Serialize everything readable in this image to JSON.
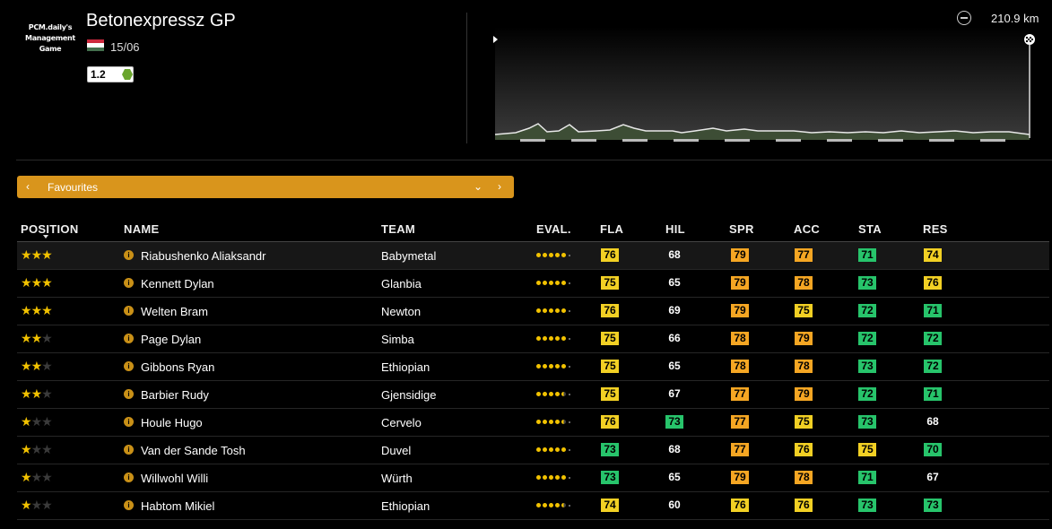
{
  "logo": {
    "line1": "PCM.daily's",
    "line2": "Management",
    "line3": "Game"
  },
  "race": {
    "title": "Betonexpressz GP",
    "date": "15/06",
    "category": "1.2",
    "flag_colors": [
      "#cd2a3e",
      "#ffffff",
      "#436f4d"
    ],
    "distance": "210.9 km"
  },
  "selector": {
    "label": "Favourites",
    "prev_icon": "chevron-left-icon",
    "dropdown_icon": "chevron-down-icon",
    "next_icon": "chevron-right-icon"
  },
  "colors": {
    "accent": "#d9951c",
    "orange": "#f5a623",
    "yellow": "#f2d024",
    "green": "#27c46b",
    "category_green": "#6aa52d"
  },
  "table": {
    "columns": [
      "POSITION",
      "NAME",
      "TEAM",
      "EVAL.",
      "FLA",
      "HIL",
      "SPR",
      "ACC",
      "STA",
      "RES"
    ],
    "rows": [
      {
        "stars": 3,
        "name": "Riabushenko Aliaksandr",
        "team": "Babymetal",
        "eval": 5,
        "FLA": "76",
        "HIL": "68",
        "SPR": "79",
        "ACC": "77",
        "STA": "71",
        "RES": "74"
      },
      {
        "stars": 3,
        "name": "Kennett Dylan",
        "team": "Glanbia",
        "eval": 5,
        "FLA": "75",
        "HIL": "65",
        "SPR": "79",
        "ACC": "78",
        "STA": "73",
        "RES": "76"
      },
      {
        "stars": 3,
        "name": "Welten Bram",
        "team": "Newton",
        "eval": 5,
        "FLA": "76",
        "HIL": "69",
        "SPR": "79",
        "ACC": "75",
        "STA": "72",
        "RES": "71"
      },
      {
        "stars": 2,
        "name": "Page Dylan",
        "team": "Simba",
        "eval": 5,
        "FLA": "75",
        "HIL": "66",
        "SPR": "78",
        "ACC": "79",
        "STA": "72",
        "RES": "72"
      },
      {
        "stars": 2,
        "name": "Gibbons Ryan",
        "team": "Ethiopian",
        "eval": 5,
        "FLA": "75",
        "HIL": "65",
        "SPR": "78",
        "ACC": "78",
        "STA": "73",
        "RES": "72"
      },
      {
        "stars": 2,
        "name": "Barbier Rudy",
        "team": "Gjensidige",
        "eval": 4.5,
        "FLA": "75",
        "HIL": "67",
        "SPR": "77",
        "ACC": "79",
        "STA": "72",
        "RES": "71"
      },
      {
        "stars": 1,
        "name": "Houle Hugo",
        "team": "Cervelo",
        "eval": 4.5,
        "FLA": "76",
        "HIL": "73",
        "SPR": "77",
        "ACC": "75",
        "STA": "73",
        "RES": "68"
      },
      {
        "stars": 1,
        "name": "Van der Sande Tosh",
        "team": "Duvel",
        "eval": 5,
        "FLA": "73",
        "HIL": "68",
        "SPR": "77",
        "ACC": "76",
        "STA": "75",
        "RES": "70"
      },
      {
        "stars": 1,
        "name": "Willwohl Willi",
        "team": "Würth",
        "eval": 5,
        "FLA": "73",
        "HIL": "65",
        "SPR": "79",
        "ACC": "78",
        "STA": "71",
        "RES": "67"
      },
      {
        "stars": 1,
        "name": "Habtom Mikiel",
        "team": "Ethiopian",
        "eval": 4.5,
        "FLA": "74",
        "HIL": "60",
        "SPR": "76",
        "ACC": "76",
        "STA": "73",
        "RES": "73"
      }
    ]
  }
}
